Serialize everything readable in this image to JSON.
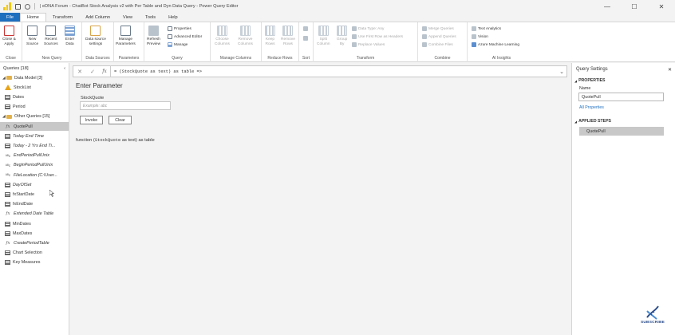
{
  "titlebar": {
    "title": "| eDNA Forum - ChatBot Stock Analysis v2 with Per Table and Dyn Data Query - Power Query Editor",
    "window_controls": [
      "—",
      "☐",
      "✕"
    ]
  },
  "tabs": [
    "File",
    "Home",
    "Transform",
    "Add Column",
    "View",
    "Tools",
    "Help"
  ],
  "ribbon": {
    "close": {
      "label1": "Close &",
      "label2": "Apply",
      "group": "Close"
    },
    "new_query": {
      "new_source": [
        "New",
        "Source"
      ],
      "recent_sources": [
        "Recent",
        "Sources"
      ],
      "enter_data": [
        "Enter",
        "Data"
      ],
      "group": "New Query"
    },
    "data_sources": {
      "settings": [
        "Data source",
        "settings"
      ],
      "group": "Data Sources"
    },
    "parameters": {
      "manage": [
        "Manage",
        "Parameters"
      ],
      "group": "Parameters"
    },
    "query": {
      "refresh": [
        "Refresh",
        "Preview"
      ],
      "properties": "Properties",
      "advanced_editor": "Advanced Editor",
      "manage": "Manage",
      "group": "Query"
    },
    "manage_columns": {
      "choose": [
        "Choose",
        "Columns"
      ],
      "remove": [
        "Remove",
        "Columns"
      ],
      "group": "Manage Columns"
    },
    "reduce_rows": {
      "keep": [
        "Keep",
        "Rows"
      ],
      "remove": [
        "Remove",
        "Rows"
      ],
      "group": "Reduce Rows"
    },
    "sort": {
      "group": "Sort"
    },
    "transform": {
      "split": [
        "Split",
        "Column"
      ],
      "group_by": [
        "Group",
        "By"
      ],
      "data_type": "Data Type: Any",
      "first_row": "Use First Row as Headers",
      "replace": "Replace Values",
      "group": "Transform"
    },
    "combine": {
      "merge": "Merge Queries",
      "append": "Append Queries",
      "combine_files": "Combine Files",
      "group": "Combine"
    },
    "ai": {
      "text_analytics": "Text Analytics",
      "vision": "Vision",
      "azure_ml": "Azure Machine Learning",
      "group": "AI Insights"
    }
  },
  "queries_pane": {
    "title": "Queries [18]",
    "collapse": "‹",
    "items": [
      {
        "label": "Data Model [3]",
        "kind": "folder",
        "indent": 0
      },
      {
        "label": "StockList",
        "kind": "warn",
        "indent": 1
      },
      {
        "label": "Dates",
        "kind": "table",
        "indent": 1
      },
      {
        "label": "Period",
        "kind": "table",
        "indent": 1
      },
      {
        "label": "Other Queries [15]",
        "kind": "folder",
        "indent": 0
      },
      {
        "label": "QuotePull",
        "kind": "fx",
        "indent": 1,
        "selected": true
      },
      {
        "label": "Today End Time",
        "kind": "table",
        "indent": 1,
        "italic": true
      },
      {
        "label": "Today - 2 Yrs End Ti...",
        "kind": "table",
        "indent": 1,
        "italic": true
      },
      {
        "label": "EndPeriodPullUnix",
        "kind": "abc",
        "indent": 1,
        "italic": true
      },
      {
        "label": "BeginPeriodPullUnix",
        "kind": "abc",
        "indent": 1,
        "italic": true
      },
      {
        "label": "FileLocation (C:\\User...",
        "kind": "abc",
        "indent": 1,
        "italic": true
      },
      {
        "label": "DayOfSet",
        "kind": "table",
        "indent": 1,
        "italic": true
      },
      {
        "label": "fxStartDate",
        "kind": "table",
        "indent": 1
      },
      {
        "label": "fxEndDate",
        "kind": "table",
        "indent": 1
      },
      {
        "label": "Extended Date Table",
        "kind": "fx",
        "indent": 1,
        "italic": true
      },
      {
        "label": "MinDates",
        "kind": "table",
        "indent": 1
      },
      {
        "label": "MaxDates",
        "kind": "table",
        "indent": 1
      },
      {
        "label": "CreatePeriodTable",
        "kind": "fx",
        "indent": 1,
        "italic": true
      },
      {
        "label": "Chart Selection",
        "kind": "table",
        "indent": 1
      },
      {
        "label": "Key Measures",
        "kind": "table",
        "indent": 1
      }
    ]
  },
  "formula_bar": {
    "cancel": "✕",
    "commit": "✓",
    "fx": "fx",
    "text": "= (StockQuote as text) as table =>",
    "expand": "⌄"
  },
  "parameter": {
    "title": "Enter Parameter",
    "field_label": "StockQuote",
    "placeholder": "Example: abc",
    "invoke": "Invoke",
    "clear": "Clear"
  },
  "function_sig": {
    "prefix": "function (",
    "param": "StockQuote",
    "suffix": " as text) as table"
  },
  "settings_pane": {
    "title": "Query Settings",
    "close": "✕",
    "properties_head": "PROPERTIES",
    "name_label": "Name",
    "name_value": "QuotePull",
    "all_properties": "All Properties",
    "applied_steps_head": "APPLIED STEPS",
    "steps": [
      "QuotePull"
    ]
  },
  "watermark": {
    "text": "SUBSCRIBE"
  },
  "colors": {
    "accent": "#1f6fbf",
    "folder": "#e2b14a",
    "warning": "#e8a317",
    "selected": "#c8c8c8"
  }
}
